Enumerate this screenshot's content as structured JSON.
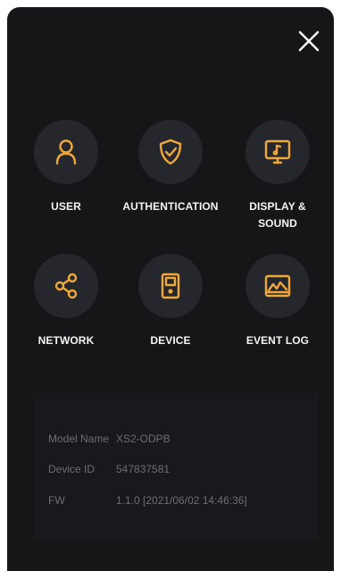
{
  "close": {
    "icon": "close-icon"
  },
  "menu": {
    "user": "USER",
    "authentication": "AUTHENTICATION",
    "display_sound": "DISPLAY &\nSOUND",
    "network": "NETWORK",
    "device": "DEVICE",
    "event_log": "EVENT LOG"
  },
  "colors": {
    "accent": "#f0a83a",
    "background": "#151618",
    "circle": "#25272c",
    "info_text": "#6b6e74"
  },
  "info": {
    "model_name_label": "Model Name",
    "model_name_value": "XS2-ODPB",
    "device_id_label": "Device ID",
    "device_id_value": "547837581",
    "fw_label": "FW",
    "fw_value": "1.1.0 [2021/06/02 14:46:36]"
  }
}
